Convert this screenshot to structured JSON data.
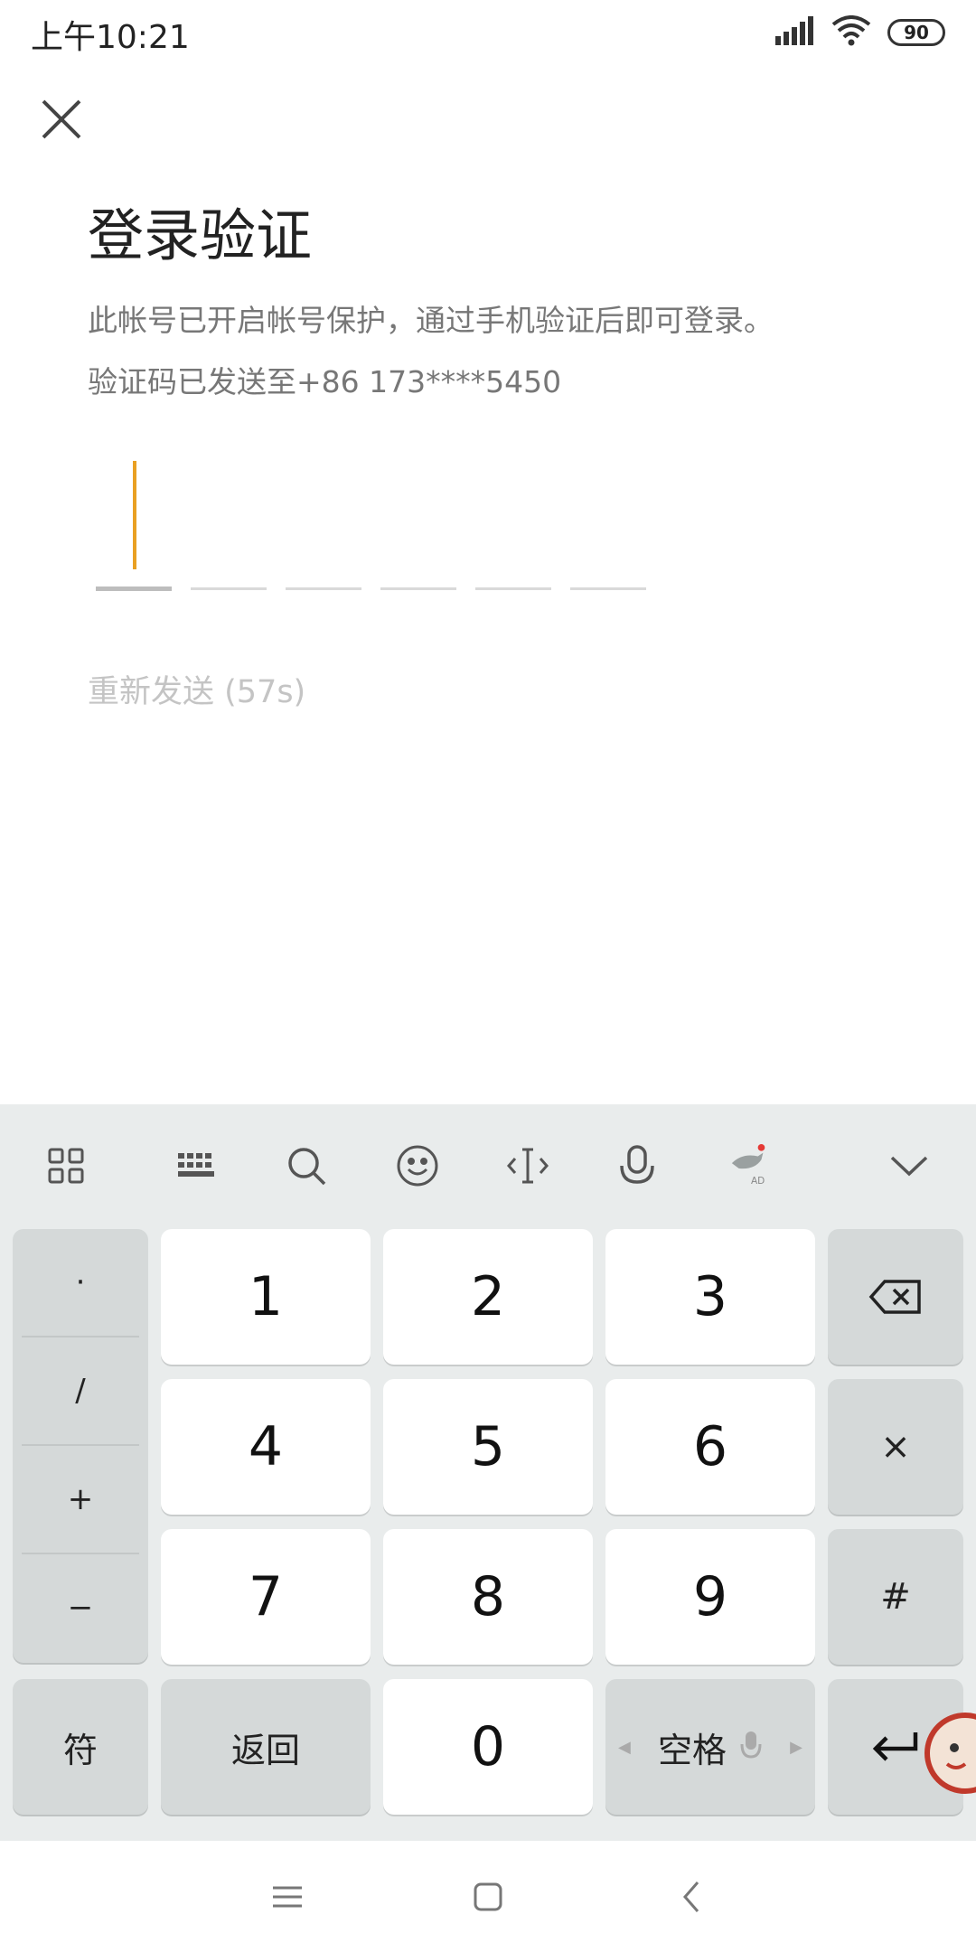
{
  "status_bar": {
    "time": "上午10:21",
    "battery": "90"
  },
  "page": {
    "title": "登录验证",
    "description": "此帐号已开启帐号保护，通过手机验证后即可登录。",
    "sent_to": "验证码已发送至+86 173****5450",
    "resend": "重新发送 (57s)",
    "code_slots": 6
  },
  "keyboard": {
    "toolbar_icons": [
      "apps-grid-icon",
      "keyboard-icon",
      "search-icon",
      "emoji-icon",
      "cursor-move-icon",
      "microphone-icon",
      "ad-bird-icon",
      "collapse-chevron-icon"
    ],
    "symbols": [
      "·",
      "/",
      "+",
      "−"
    ],
    "digits": [
      "1",
      "2",
      "3",
      "4",
      "5",
      "6",
      "7",
      "8",
      "9",
      "0"
    ],
    "right_keys": [
      "×",
      "#"
    ],
    "bottom": {
      "symbols_label": "符",
      "back_label": "返回",
      "space_label": "空格"
    }
  },
  "colors": {
    "cursor": "#e9a023",
    "keyboard_bg": "#e9ecec",
    "key_white": "#ffffff",
    "key_gray": "#d5d9d9"
  }
}
